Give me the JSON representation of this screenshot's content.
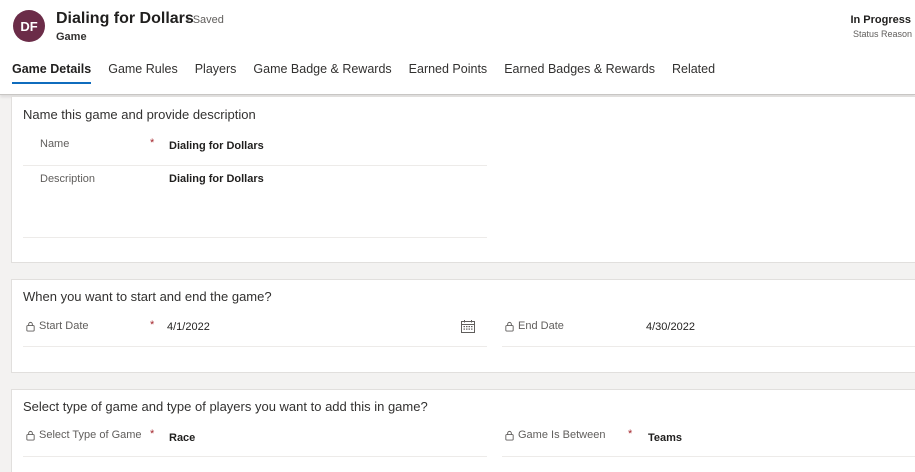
{
  "header": {
    "avatar_initials": "DF",
    "title": "Dialing for Dollars",
    "saved_status": "- Saved",
    "entity": "Game",
    "status_value": "In Progress",
    "status_label": "Status Reason"
  },
  "tabs": [
    {
      "label": "Game Details",
      "active": true
    },
    {
      "label": "Game Rules"
    },
    {
      "label": "Players"
    },
    {
      "label": "Game Badge & Rewards"
    },
    {
      "label": "Earned Points"
    },
    {
      "label": "Earned Badges & Rewards"
    },
    {
      "label": "Related"
    }
  ],
  "section_name": {
    "title": "Name this game and provide description",
    "name_label": "Name",
    "name_value": "Dialing for Dollars",
    "description_label": "Description",
    "description_value": "Dialing for Dollars"
  },
  "section_dates": {
    "title": "When you want to start and end the game?",
    "start_label": "Start Date",
    "start_value": "4/1/2022",
    "end_label": "End Date",
    "end_value": "4/30/2022"
  },
  "section_type": {
    "title": "Select type of game and type of players you want to add this in game?",
    "type_label": "Select Type of Game",
    "type_value": "Race",
    "between_label": "Game Is Between",
    "between_value": "Teams"
  },
  "required_marker": "*",
  "icons": [
    "lock-icon",
    "calendar-icon"
  ],
  "colors": {
    "avatar": "#6b2c48",
    "active_tab": "#0f6cbd",
    "required": "#a4262c"
  }
}
